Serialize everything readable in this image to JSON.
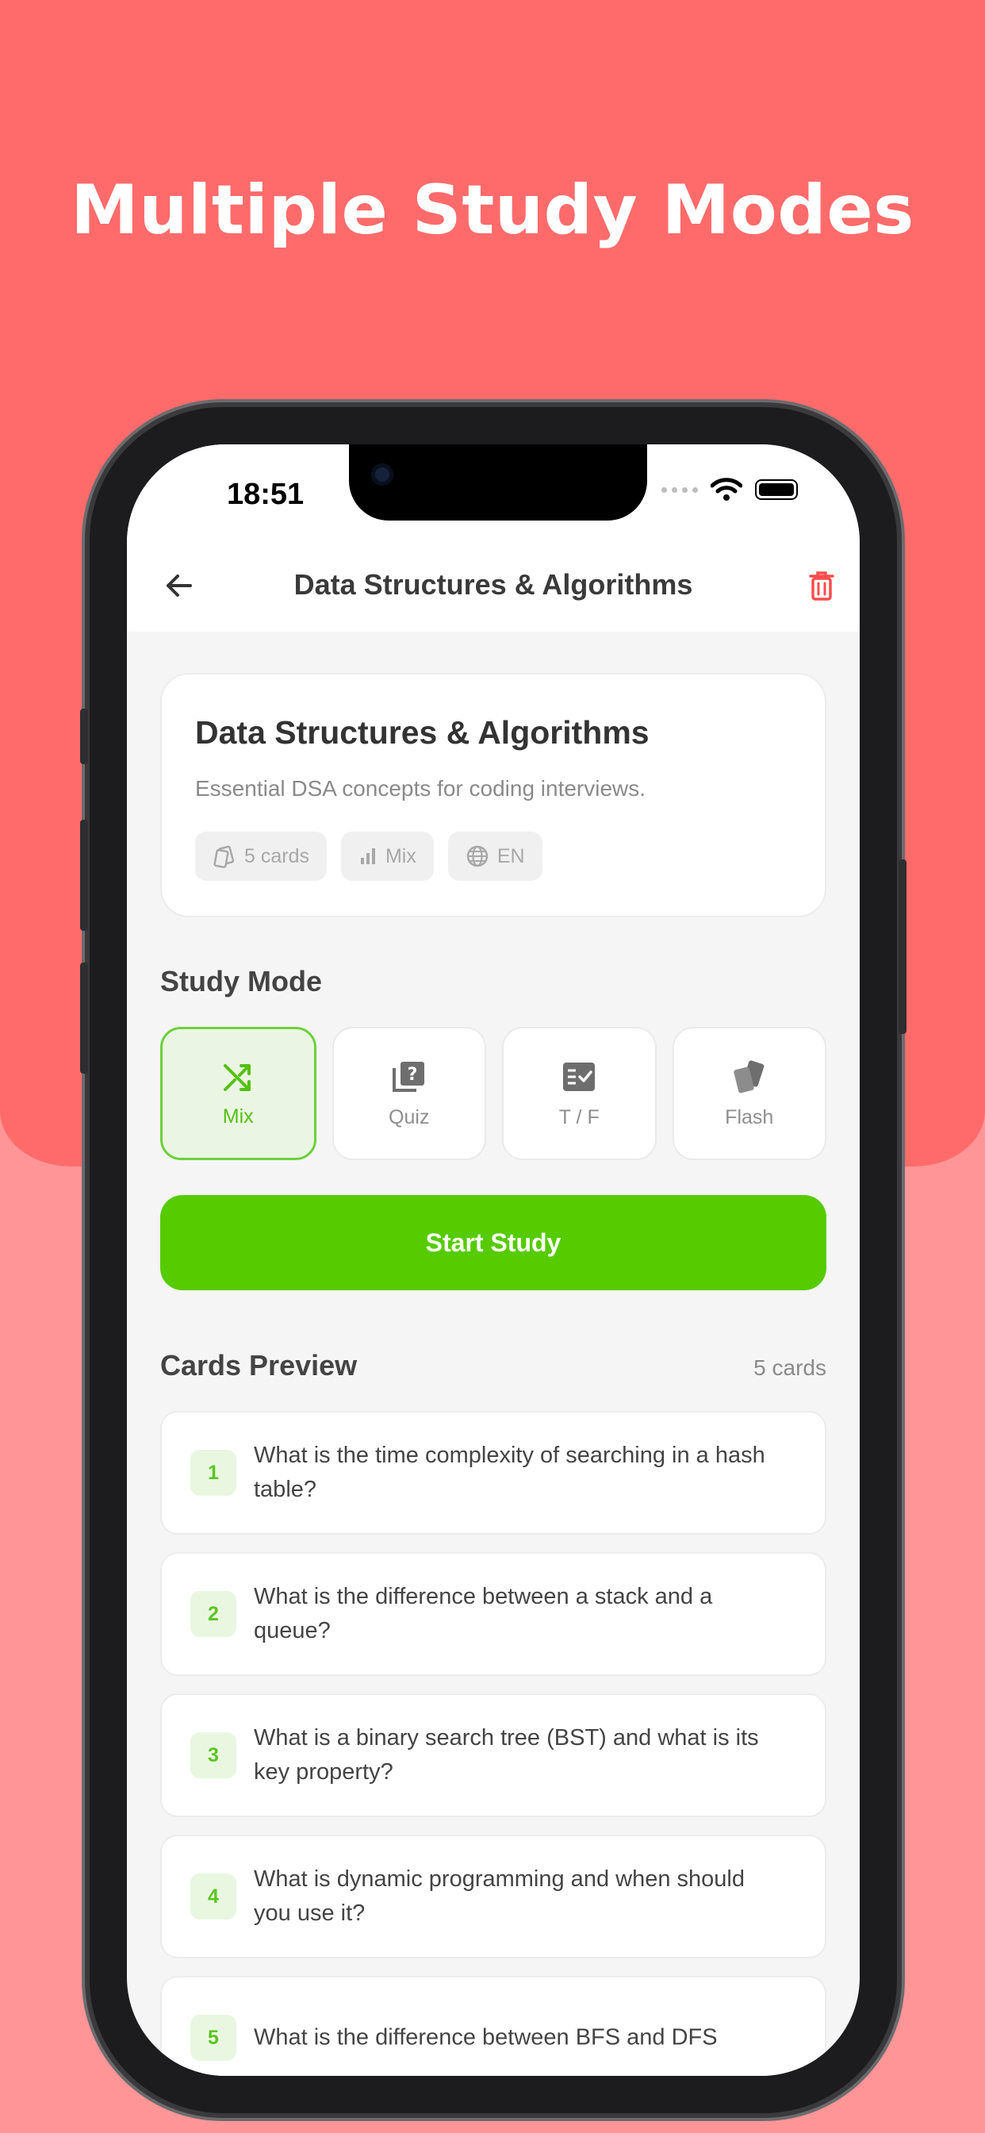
{
  "headline": "Multiple Study Modes",
  "status_bar": {
    "time": "18:51"
  },
  "header": {
    "title": "Data Structures & Algorithms",
    "back_icon": "arrow-left-icon",
    "delete_icon": "trash-icon"
  },
  "deck": {
    "title": "Data Structures & Algorithms",
    "description": "Essential DSA concepts for coding interviews.",
    "chips": [
      {
        "icon": "cards-icon",
        "label": "5 cards"
      },
      {
        "icon": "bar-chart-icon",
        "label": "Mix"
      },
      {
        "icon": "globe-icon",
        "label": "EN"
      }
    ]
  },
  "study_mode": {
    "title": "Study Mode",
    "selected": "Mix",
    "modes": [
      {
        "label": "Mix",
        "icon": "shuffle-icon"
      },
      {
        "label": "Quiz",
        "icon": "quiz-icon"
      },
      {
        "label": "T / F",
        "icon": "checklist-icon"
      },
      {
        "label": "Flash",
        "icon": "flashcards-icon"
      }
    ]
  },
  "start_button": "Start Study",
  "preview": {
    "title": "Cards Preview",
    "count": "5 cards",
    "questions": [
      {
        "num": "1",
        "text": "What is the time complexity of searching in a hash table?"
      },
      {
        "num": "2",
        "text": "What is the difference between a stack and a queue?"
      },
      {
        "num": "3",
        "text": "What is a binary search tree (BST) and what is its key property?"
      },
      {
        "num": "4",
        "text": "What is dynamic programming and when should you use it?"
      },
      {
        "num": "5",
        "text": "What is the difference between BFS and DFS"
      }
    ]
  },
  "colors": {
    "background_top": "#FF6B6B",
    "background_bottom": "#FF9596",
    "accent_green": "#56CB00",
    "delete_red": "#FF4D4D"
  }
}
